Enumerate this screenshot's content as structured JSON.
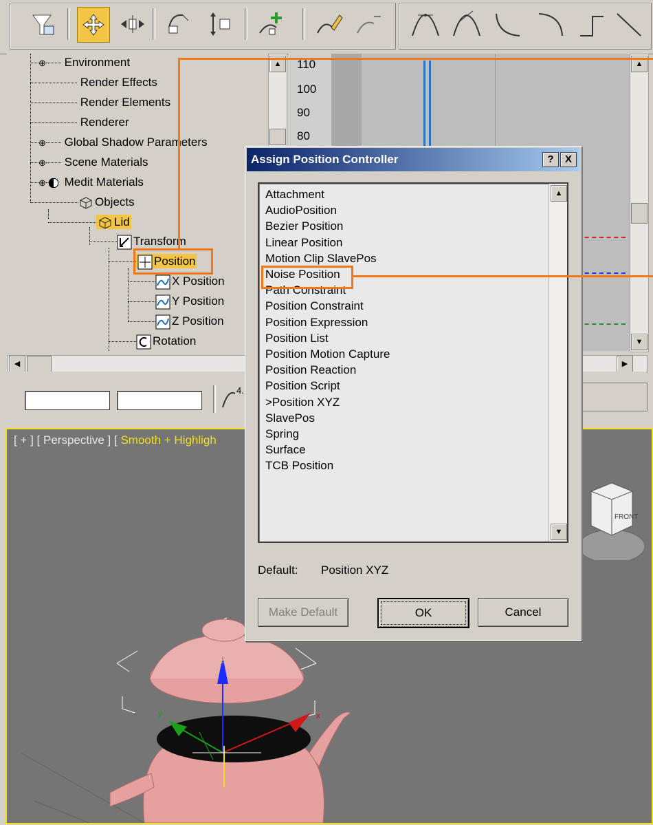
{
  "toolbar": {
    "buttons": [
      "filter-icon",
      "move-keys-icon",
      "slide-keys-icon",
      "scale-keys-icon",
      "scale-values-icon",
      "add-keys-icon",
      "draw-curves-icon",
      "reduce-keys-icon",
      "tangent-auto-icon",
      "tangent-spline-icon",
      "tangent-fast-icon",
      "tangent-slow-icon",
      "tangent-step-icon",
      "tangent-linear-icon"
    ]
  },
  "tree": {
    "items": [
      {
        "label": "Environment"
      },
      {
        "label": "Render Effects"
      },
      {
        "label": "Render Elements"
      },
      {
        "label": "Renderer"
      },
      {
        "label": "Global Shadow Parameters"
      },
      {
        "label": "Scene Materials"
      },
      {
        "label": "Medit Materials"
      },
      {
        "label": "Objects"
      },
      {
        "label": "Lid"
      },
      {
        "label": "Transform"
      },
      {
        "label": "Position"
      },
      {
        "label": "X Position"
      },
      {
        "label": "Y Position"
      },
      {
        "label": "Z Position"
      },
      {
        "label": "Rotation"
      }
    ]
  },
  "curve_editor": {
    "ruler": [
      "110",
      "100",
      "90",
      "80"
    ],
    "readout": "4."
  },
  "viewport": {
    "label_prefix": "[ + ] [ Perspective ] [ ",
    "label_shading": "Smooth + Highligh",
    "viewcube_face": "FRONT",
    "axes": {
      "x": "x",
      "y": "y",
      "z": "z"
    },
    "colors": {
      "border": "#f0e020",
      "teapot": "#e6a0a0"
    }
  },
  "dialog": {
    "title": "Assign Position Controller",
    "help_button": "?",
    "close_button": "X",
    "controllers": [
      "Attachment",
      "AudioPosition",
      "Bezier Position",
      "Linear Position",
      "Motion Clip SlavePos",
      "Noise Position",
      "Path Constraint",
      "Position Constraint",
      "Position Expression",
      "Position List",
      "Position Motion Capture",
      "Position Reaction",
      "Position Script",
      ">Position XYZ",
      "SlavePos",
      "Spring",
      "Surface",
      "TCB Position"
    ],
    "default_label": "Default:",
    "default_value": "Position XYZ",
    "make_default_button": "Make Default",
    "ok_button": "OK",
    "cancel_button": "Cancel"
  },
  "annotations": {
    "highlight_color": "#f07818"
  }
}
